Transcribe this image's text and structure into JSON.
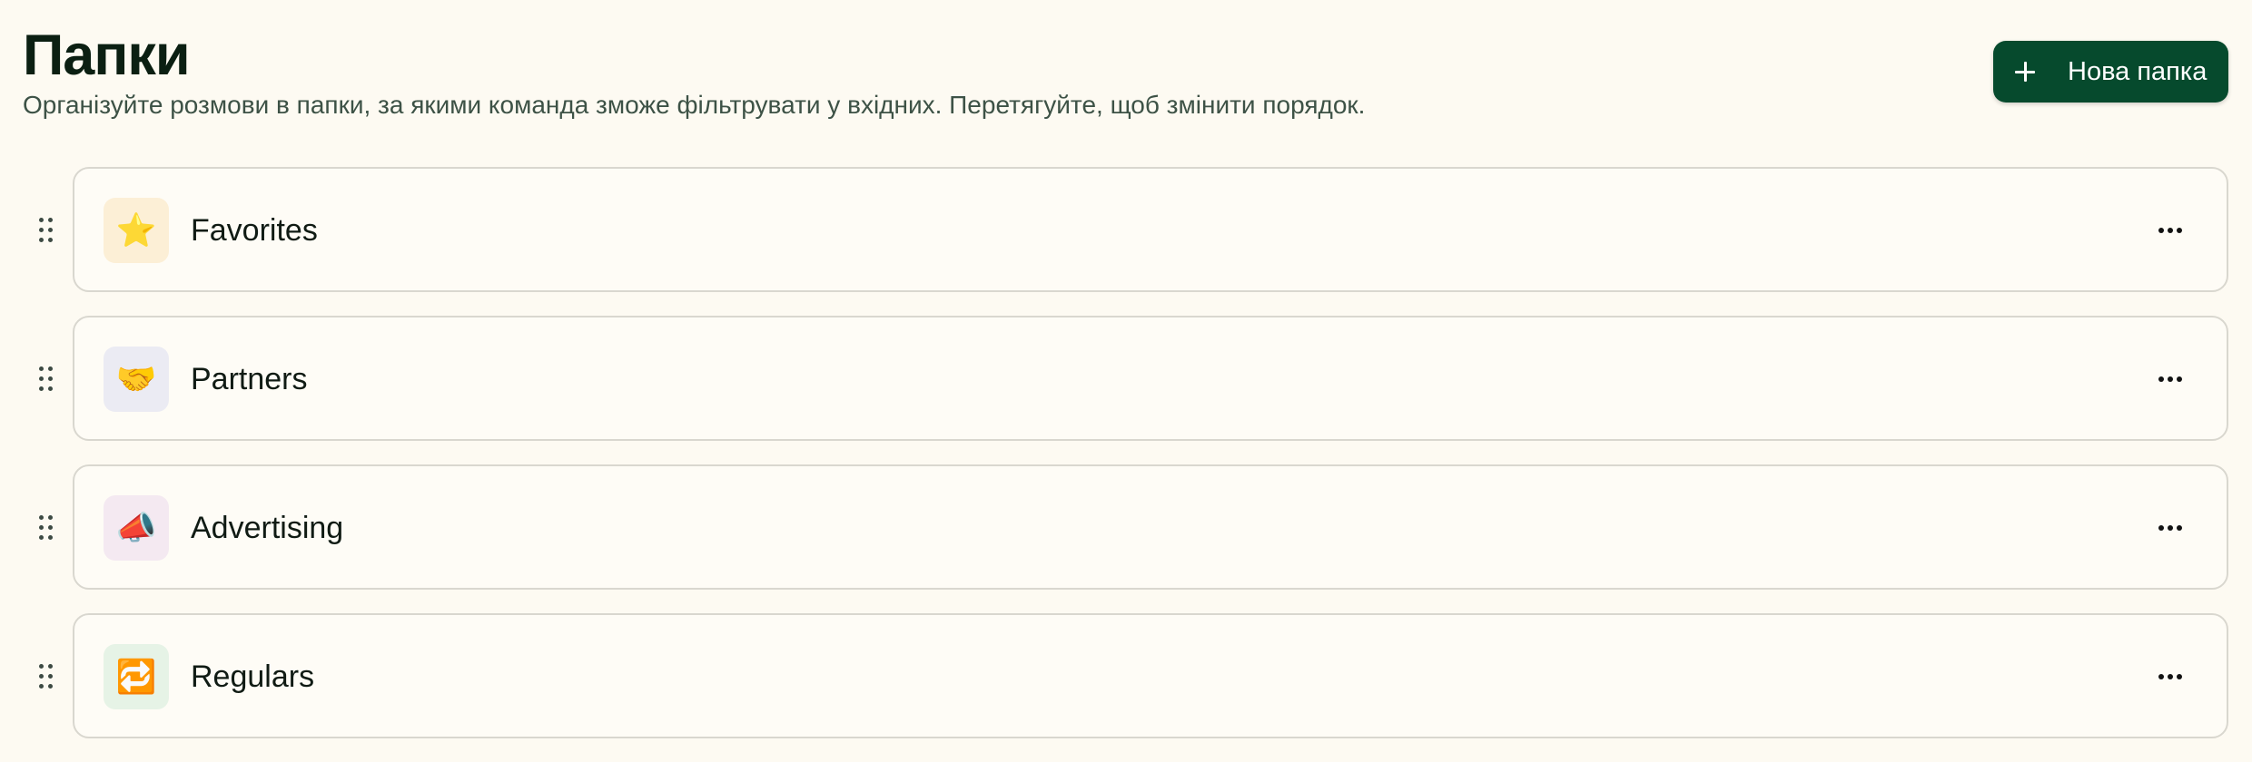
{
  "header": {
    "title": "Папки",
    "subtitle": "Організуйте розмови в папки, за якими команда зможе фільтрувати у вхідних. Перетягуйте, щоб змінити порядок.",
    "new_folder_label": "Нова папка"
  },
  "folders": [
    {
      "name": "Favorites",
      "emoji": "⭐",
      "icon": "star-icon",
      "emoji_bg": "#fcefd6"
    },
    {
      "name": "Partners",
      "emoji": "🤝",
      "icon": "handshake-icon",
      "emoji_bg": "#ebebf3"
    },
    {
      "name": "Advertising",
      "emoji": "📣",
      "icon": "megaphone-icon",
      "emoji_bg": "#f4e9f1"
    },
    {
      "name": "Regulars",
      "emoji": "🔁",
      "icon": "repeat-icon",
      "emoji_bg": "#e6f3e6"
    }
  ],
  "colors": {
    "background": "#fdfaf2",
    "primary_button": "#064a2d",
    "card_border": "#d9d7cf"
  }
}
